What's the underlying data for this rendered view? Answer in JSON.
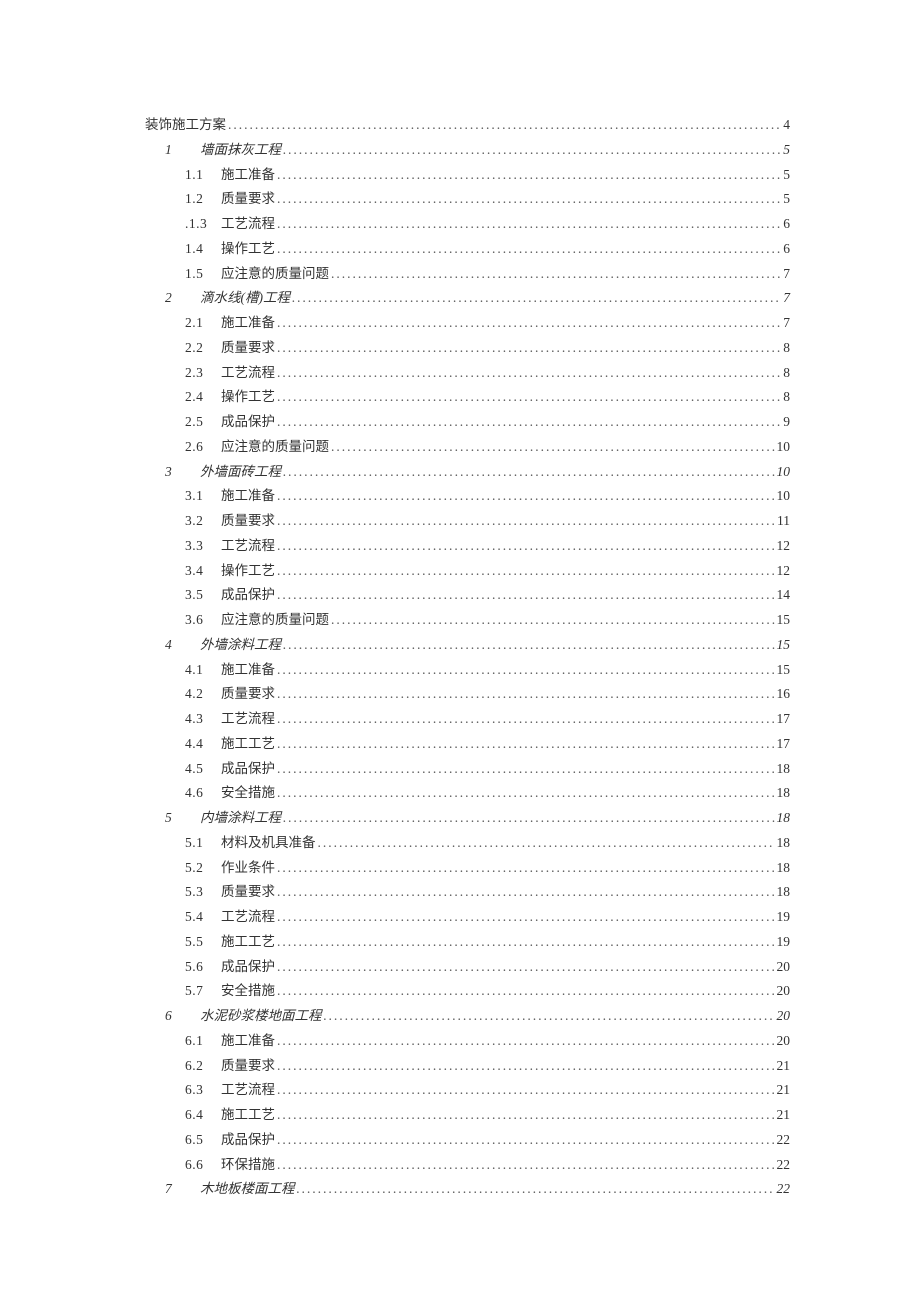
{
  "toc": [
    {
      "level": 0,
      "num": "",
      "title": "装饰施工方案",
      "page": "4"
    },
    {
      "level": 1,
      "num": "1",
      "title": "墙面抹灰工程",
      "page": "5"
    },
    {
      "level": 2,
      "num": "1.1",
      "title": "施工准备",
      "page": "5"
    },
    {
      "level": 2,
      "num": "1.2",
      "title": "质量要求",
      "page": "5"
    },
    {
      "level": 2,
      "num": ".1.3",
      "title": "工艺流程",
      "page": "6"
    },
    {
      "level": 2,
      "num": "1.4",
      "title": "操作工艺",
      "page": "6"
    },
    {
      "level": 2,
      "num": "1.5",
      "title": "应注意的质量问题",
      "page": "7"
    },
    {
      "level": 1,
      "num": "2",
      "title": "滴水线(槽)工程",
      "page": "7"
    },
    {
      "level": 2,
      "num": "2.1",
      "title": "施工准备",
      "page": "7"
    },
    {
      "level": 2,
      "num": "2.2",
      "title": "质量要求",
      "page": "8"
    },
    {
      "level": 2,
      "num": "2.3",
      "title": "工艺流程",
      "page": "8"
    },
    {
      "level": 2,
      "num": "2.4",
      "title": "操作工艺",
      "page": "8"
    },
    {
      "level": 2,
      "num": "2.5",
      "title": "成品保护",
      "page": "9"
    },
    {
      "level": 2,
      "num": "2.6",
      "title": "应注意的质量问题",
      "page": "10"
    },
    {
      "level": 1,
      "num": "3",
      "title": "外墙面砖工程",
      "page": "10"
    },
    {
      "level": 2,
      "num": "3.1",
      "title": "施工准备",
      "page": "10"
    },
    {
      "level": 2,
      "num": "3.2",
      "title": "质量要求",
      "page": "11"
    },
    {
      "level": 2,
      "num": "3.3",
      "title": "工艺流程",
      "page": "12"
    },
    {
      "level": 2,
      "num": "3.4",
      "title": "操作工艺",
      "page": "12"
    },
    {
      "level": 2,
      "num": "3.5",
      "title": "成品保护",
      "page": "14"
    },
    {
      "level": 2,
      "num": "3.6",
      "title": "应注意的质量问题",
      "page": "15"
    },
    {
      "level": 1,
      "num": "4",
      "title": "外墙涂料工程",
      "page": "15"
    },
    {
      "level": 2,
      "num": "4.1",
      "title": "施工准备",
      "page": "15"
    },
    {
      "level": 2,
      "num": "4.2",
      "title": "质量要求",
      "page": "16"
    },
    {
      "level": 2,
      "num": "4.3",
      "title": "工艺流程",
      "page": "17"
    },
    {
      "level": 2,
      "num": "4.4",
      "title": "施工工艺",
      "page": "17"
    },
    {
      "level": 2,
      "num": "4.5",
      "title": "成品保护",
      "page": "18"
    },
    {
      "level": 2,
      "num": "4.6",
      "title": "安全措施",
      "page": "18"
    },
    {
      "level": 1,
      "num": "5",
      "title": "内墙涂料工程",
      "page": "18"
    },
    {
      "level": 2,
      "num": "5.1",
      "title": "材料及机具准备",
      "page": "18"
    },
    {
      "level": 2,
      "num": "5.2",
      "title": "作业条件",
      "page": "18"
    },
    {
      "level": 2,
      "num": "5.3",
      "title": "质量要求",
      "page": "18"
    },
    {
      "level": 2,
      "num": "5.4",
      "title": "工艺流程",
      "page": "19"
    },
    {
      "level": 2,
      "num": "5.5",
      "title": "施工工艺",
      "page": "19"
    },
    {
      "level": 2,
      "num": "5.6",
      "title": "成品保护",
      "page": "20"
    },
    {
      "level": 2,
      "num": "5.7",
      "title": "安全措施",
      "page": "20"
    },
    {
      "level": 1,
      "num": "6",
      "title": "水泥砂浆楼地面工程",
      "page": "20"
    },
    {
      "level": 2,
      "num": "6.1",
      "title": "施工准备",
      "page": "20"
    },
    {
      "level": 2,
      "num": "6.2",
      "title": "质量要求",
      "page": "21"
    },
    {
      "level": 2,
      "num": "6.3",
      "title": "工艺流程",
      "page": "21"
    },
    {
      "level": 2,
      "num": "6.4",
      "title": "施工工艺",
      "page": "21"
    },
    {
      "level": 2,
      "num": "6.5",
      "title": "成品保护",
      "page": "22"
    },
    {
      "level": 2,
      "num": "6.6",
      "title": "环保措施",
      "page": "22"
    },
    {
      "level": 1,
      "num": "7",
      "title": "木地板楼面工程",
      "page": "22"
    }
  ]
}
